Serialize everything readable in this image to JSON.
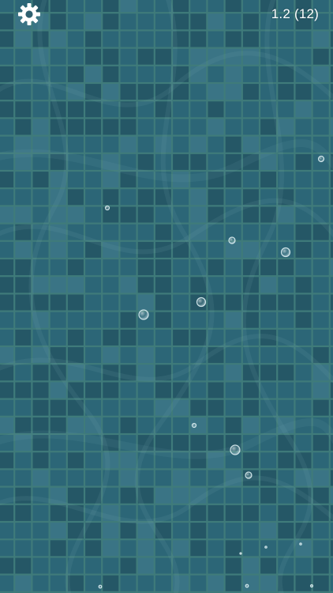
{
  "hud": {
    "level": "1.2",
    "moves": "(12)",
    "settings_icon": "gear-icon"
  },
  "colors": {
    "grout": "#3f7b7a",
    "tile_base": "#2c6677",
    "tile_dark": "#255766",
    "tile_light": "#3a7485",
    "text": "#ffffff"
  }
}
